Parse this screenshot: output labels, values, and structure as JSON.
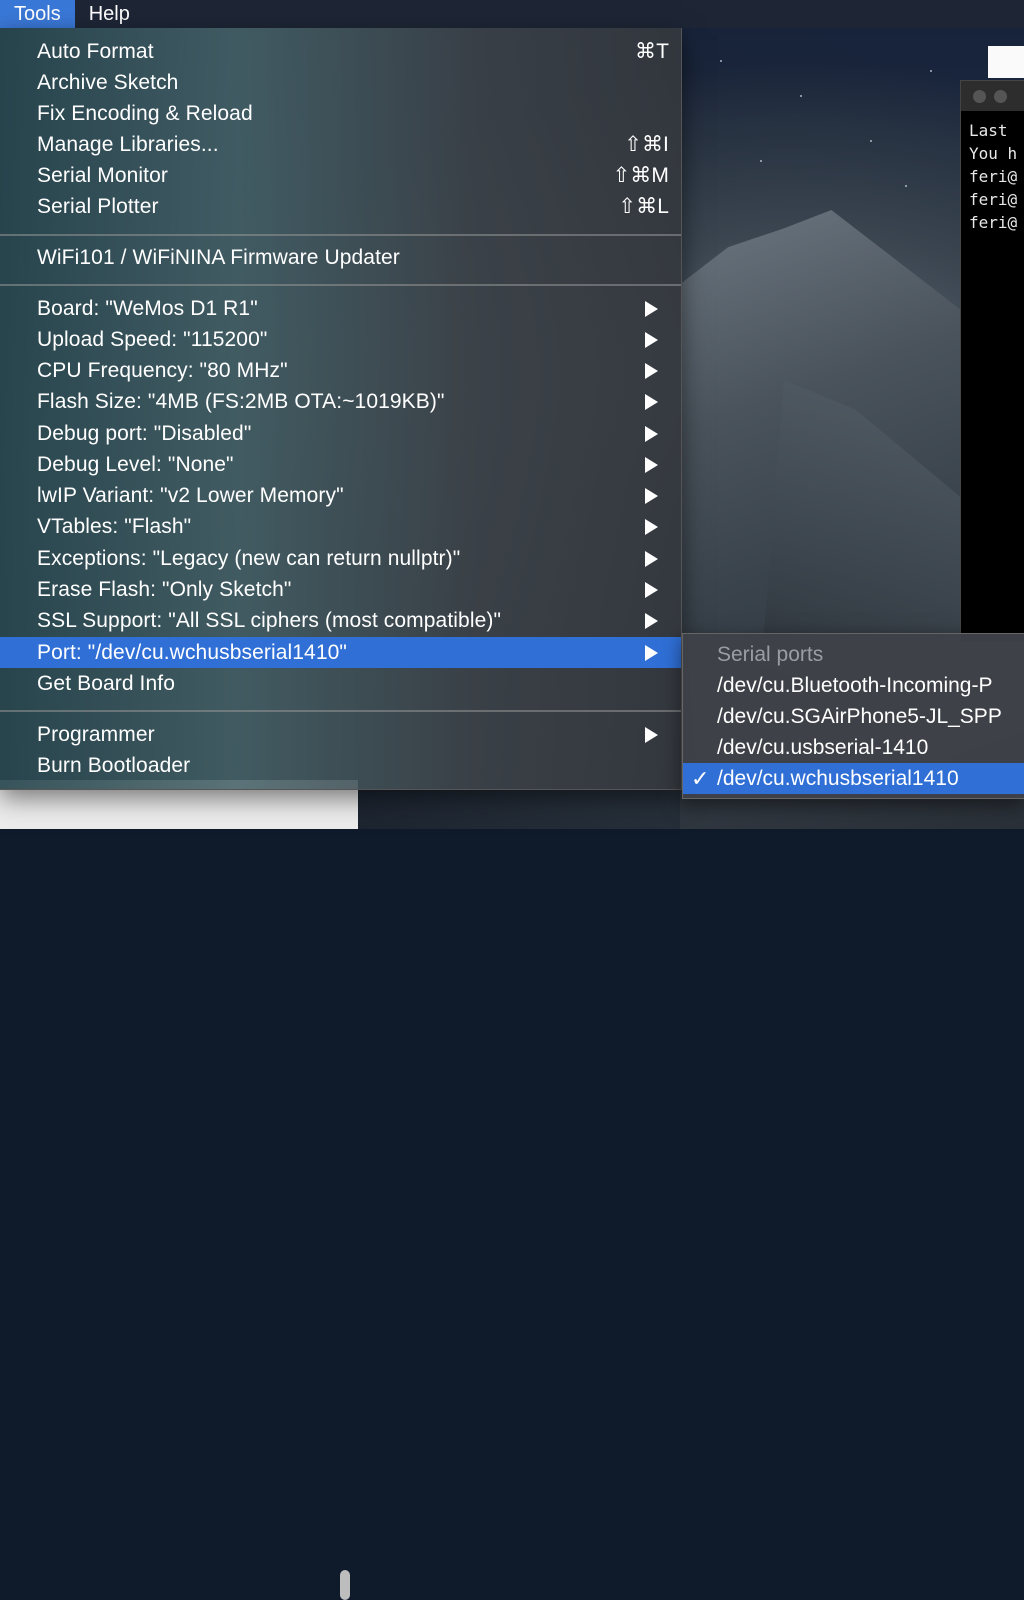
{
  "menubar": {
    "items": [
      {
        "label": "Tools"
      },
      {
        "label": "Help"
      }
    ]
  },
  "tools_menu": {
    "group1": [
      {
        "label": "Auto Format",
        "shortcut": "⌘T"
      },
      {
        "label": "Archive Sketch",
        "shortcut": ""
      },
      {
        "label": "Fix Encoding & Reload",
        "shortcut": ""
      },
      {
        "label": "Manage Libraries...",
        "shortcut": "⇧⌘I"
      },
      {
        "label": "Serial Monitor",
        "shortcut": "⇧⌘M"
      },
      {
        "label": "Serial Plotter",
        "shortcut": "⇧⌘L"
      }
    ],
    "group2": [
      {
        "label": "WiFi101 / WiFiNINA Firmware Updater"
      }
    ],
    "group3": [
      {
        "label": "Board: \"WeMos D1 R1\""
      },
      {
        "label": "Upload Speed: \"115200\""
      },
      {
        "label": "CPU Frequency: \"80 MHz\""
      },
      {
        "label": "Flash Size: \"4MB (FS:2MB OTA:~1019KB)\""
      },
      {
        "label": "Debug port: \"Disabled\""
      },
      {
        "label": "Debug Level: \"None\""
      },
      {
        "label": "lwIP Variant: \"v2 Lower Memory\""
      },
      {
        "label": "VTables: \"Flash\""
      },
      {
        "label": "Exceptions: \"Legacy (new can return nullptr)\""
      },
      {
        "label": "Erase Flash: \"Only Sketch\""
      },
      {
        "label": "SSL Support: \"All SSL ciphers (most compatible)\""
      },
      {
        "label": "Port: \"/dev/cu.wchusbserial1410\""
      },
      {
        "label": "Get Board Info"
      }
    ],
    "group4": [
      {
        "label": "Programmer"
      },
      {
        "label": "Burn Bootloader"
      }
    ]
  },
  "port_submenu": {
    "header": "Serial ports",
    "items": [
      {
        "label": "/dev/cu.Bluetooth-Incoming-P"
      },
      {
        "label": "/dev/cu.SGAirPhone5-JL_SPP"
      },
      {
        "label": "/dev/cu.usbserial-1410"
      },
      {
        "label": "/dev/cu.wchusbserial1410"
      }
    ],
    "check": "✓"
  },
  "terminal": {
    "lines": [
      "Last",
      "You h",
      "feri@",
      "feri@",
      "feri@"
    ]
  },
  "colors": {
    "highlight": "#2f6fd6",
    "menubar": "#1e2636"
  }
}
